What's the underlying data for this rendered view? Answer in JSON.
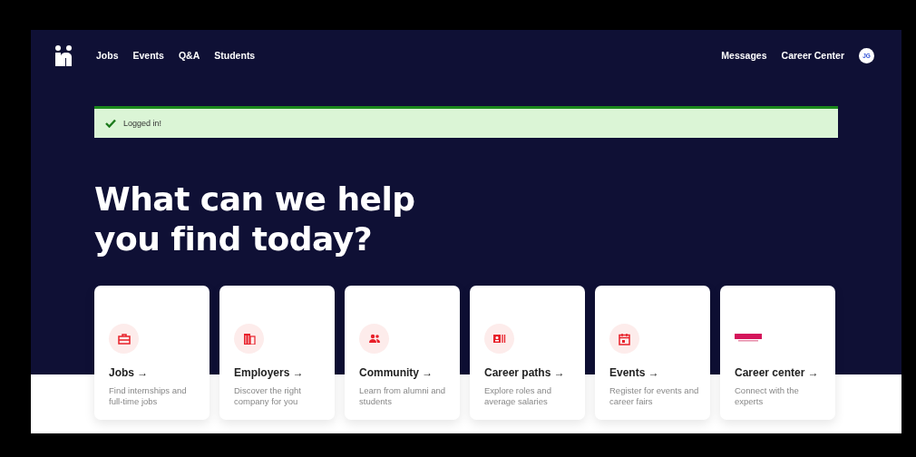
{
  "nav": {
    "links": [
      {
        "label": "Jobs"
      },
      {
        "label": "Events"
      },
      {
        "label": "Q&A"
      },
      {
        "label": "Students"
      }
    ],
    "right_links": [
      {
        "label": "Messages"
      },
      {
        "label": "Career Center"
      }
    ],
    "avatar": "JG"
  },
  "alert": {
    "kind": "success",
    "message": "Logged in!"
  },
  "heading": {
    "line_1": "What can we help",
    "line_2": "you find today?"
  },
  "cards": [
    {
      "title": "Jobs →",
      "description": "Find internships and full-time jobs"
    },
    {
      "title": "Employers →",
      "description": "Discover the right company for you"
    },
    {
      "title": "Community →",
      "description": "Learn from alumni and students"
    },
    {
      "title": "Career paths →",
      "description": "Explore roles and average salaries"
    },
    {
      "title": "Events →",
      "description": "Register for events and career fairs"
    },
    {
      "title": "Career center →",
      "description": "Connect with the experts"
    }
  ]
}
